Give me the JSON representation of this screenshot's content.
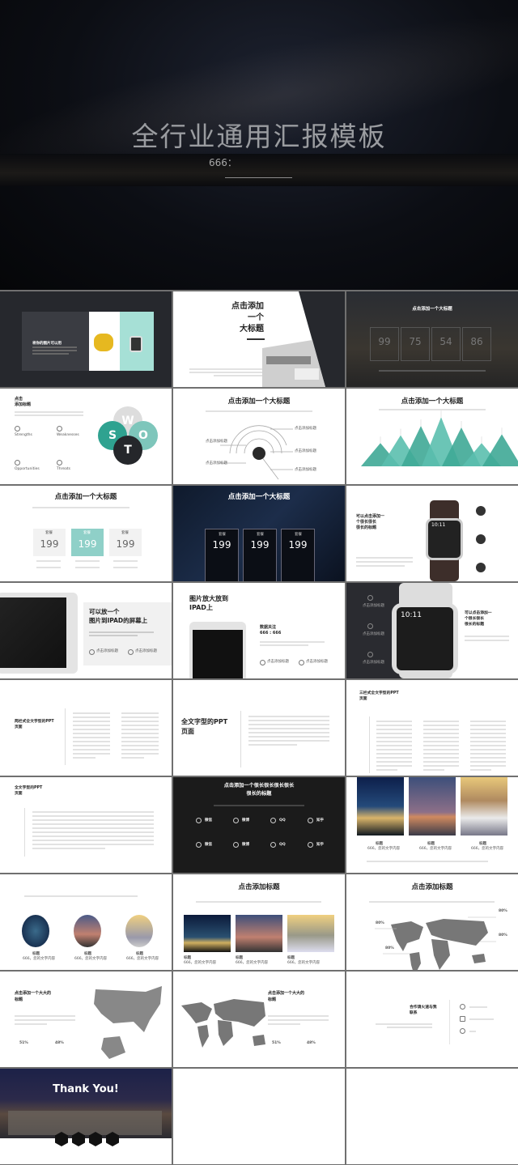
{
  "cover": {
    "title": "全行业通用汇报模板",
    "subtitle": "666："
  },
  "s1": {
    "title": "将你的图片可以用"
  },
  "s2": {
    "title": "点击添加\n一个\n大标题"
  },
  "s3": {
    "title": "点击添加一个大标题",
    "stats": [
      "99",
      "75",
      "54",
      "86"
    ]
  },
  "s4": {
    "title": "点击\n添加标题",
    "swot": [
      "Strengths",
      "Weaknesses",
      "Opportunities",
      "Threats"
    ],
    "letters": [
      "W",
      "S",
      "O",
      "T"
    ]
  },
  "s5": {
    "title": "点击添加一个大标题",
    "label": "点击添加标题"
  },
  "s6": {
    "title": "点击添加一个大标题",
    "peak_levels": [
      0.45,
      0.6,
      0.78,
      0.95,
      0.75,
      0.45,
      0.62
    ],
    "accent": "#3fa896"
  },
  "s7": {
    "title": "点击添加一个大标题",
    "plan_label": "套餐",
    "price": "199",
    "accent": "#8fd0c8"
  },
  "s8": {
    "title": "点击添加一个大标题",
    "plan_label": "套餐",
    "price": "199"
  },
  "s9": {
    "title": "可以点击添加一\n个很长很长\n很长的标题",
    "time": "10:11"
  },
  "s10": {
    "title": "可以放一个\n图片到IPAD的屏幕上",
    "label": "点击添加标题"
  },
  "s11": {
    "title": "图片放大放到\nIPAD上",
    "data_title": "数据关注\n666 : 666",
    "label": "点击添加标题"
  },
  "s12": {
    "title": "可以点击添加一\n个很长很长\n很长的标题",
    "time": "10:11",
    "label": "点击添加标题"
  },
  "s13": {
    "title": "两栏式全文字型的PPT\n页面"
  },
  "s14": {
    "title": "全文字型的PPT\n页面"
  },
  "s15": {
    "title": "三栏式全文字型的PPT\n页面"
  },
  "s16": {
    "title": "全文字型的PPT\n页面"
  },
  "s17": {
    "title": "点击添加一个很长很长很长很长\n很长的标题",
    "social": [
      "微信",
      "微博",
      "QQ",
      "知乎"
    ]
  },
  "s18": {
    "caption": "标题",
    "caption_sub": "666，您的文字内容"
  },
  "s19": {
    "caption": "标题",
    "caption_sub": "666，您的文字内容"
  },
  "s20": {
    "title": "点击添加标题",
    "caption": "标题",
    "caption_sub": "666，您的文字内容"
  },
  "s21": {
    "title": "点击添加标题",
    "percents": [
      "80%",
      "80%",
      "80%",
      "80%"
    ]
  },
  "s22": {
    "title": "点击添加一个大大的\n标题",
    "stats": [
      "51%",
      "48%"
    ]
  },
  "s23": {
    "title": "点击添加一个大大的\n标题",
    "stats": [
      "51%",
      "48%"
    ]
  },
  "s24": {
    "title": "合作请火速与我\n联系"
  },
  "s25": {
    "title": "Thank You!"
  }
}
